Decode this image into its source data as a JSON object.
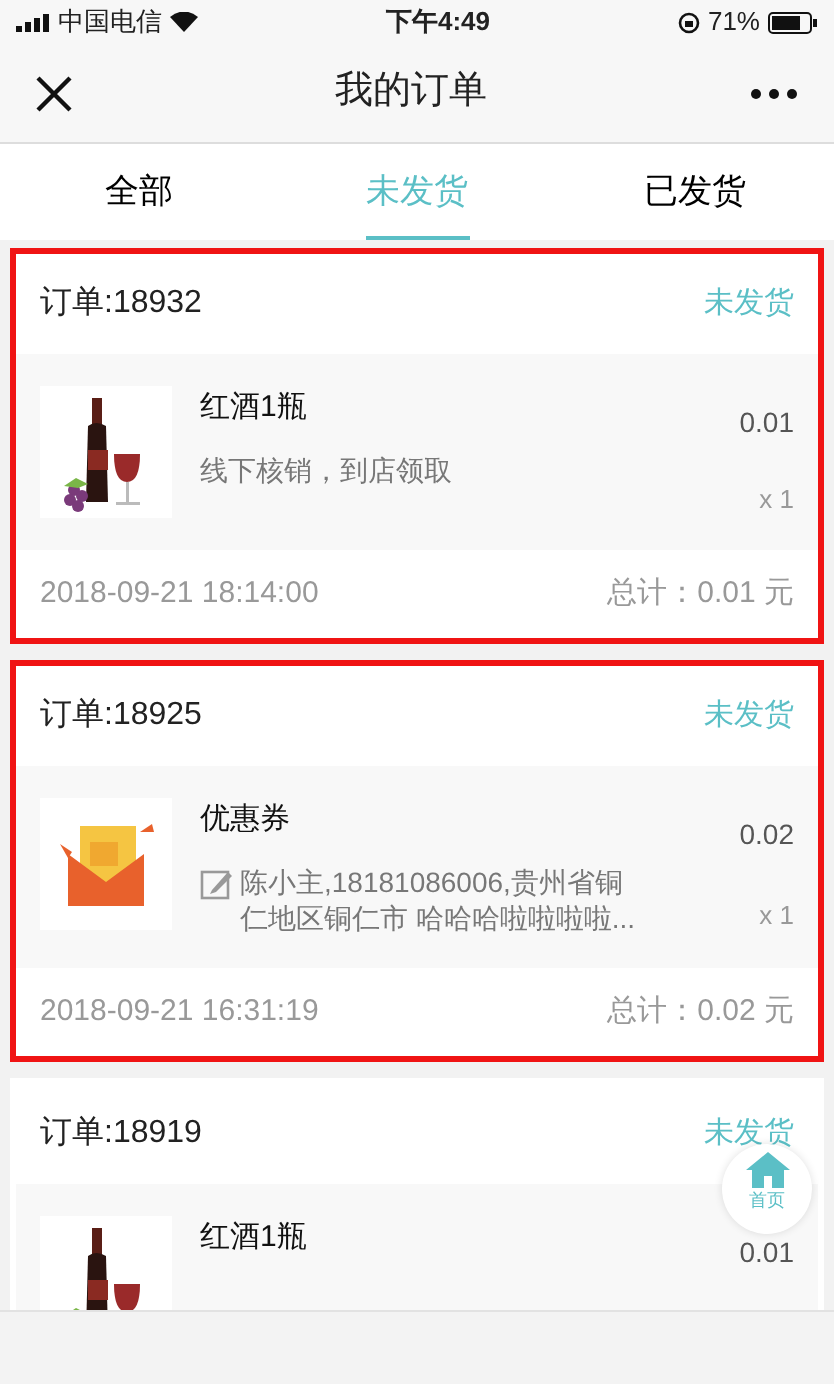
{
  "status_bar": {
    "carrier": "中国电信",
    "time": "下午4:49",
    "battery": "71%"
  },
  "nav": {
    "title": "我的订单"
  },
  "tabs": [
    {
      "label": "全部",
      "selected": false
    },
    {
      "label": "未发货",
      "selected": true
    },
    {
      "label": "已发货",
      "selected": false
    }
  ],
  "orders": [
    {
      "number": "订单:18932",
      "status": "未发货",
      "highlighted": true,
      "items": [
        {
          "kind": "wine",
          "name": "红酒1瓶",
          "note": "线下核销，到店领取",
          "note_icon": false,
          "price": "0.01",
          "qty": "x 1"
        }
      ],
      "date": "2018-09-21 18:14:00",
      "total": "总计：0.01 元"
    },
    {
      "number": "订单:18925",
      "status": "未发货",
      "highlighted": true,
      "items": [
        {
          "kind": "coupon",
          "name": "优惠券",
          "note": "陈小主,18181086006,贵州省铜仁地区铜仁市 哈哈哈啦啦啦啦...",
          "note_icon": true,
          "price": "0.02",
          "qty": "x 1"
        }
      ],
      "date": "2018-09-21 16:31:19",
      "total": "总计：0.02 元"
    },
    {
      "number": "订单:18919",
      "status": "未发货",
      "highlighted": false,
      "items": [
        {
          "kind": "wine",
          "name": "红酒1瓶",
          "price": "0.01"
        }
      ]
    }
  ],
  "home_button": {
    "label": "首页"
  }
}
